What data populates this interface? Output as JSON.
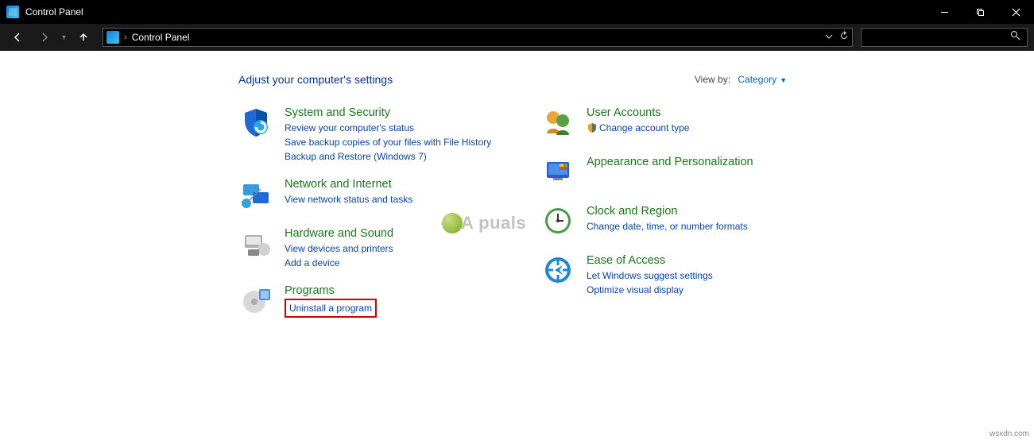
{
  "window": {
    "title": "Control Panel"
  },
  "address": {
    "path": "Control Panel"
  },
  "heading": "Adjust your computer's settings",
  "viewby": {
    "label": "View by:",
    "value": "Category"
  },
  "left_column": [
    {
      "title": "System and Security",
      "icon": "shield",
      "links": [
        {
          "text": "Review your computer's status"
        },
        {
          "text": "Save backup copies of your files with File History"
        },
        {
          "text": "Backup and Restore (Windows 7)"
        }
      ]
    },
    {
      "title": "Network and Internet",
      "icon": "network",
      "links": [
        {
          "text": "View network status and tasks"
        }
      ]
    },
    {
      "title": "Hardware and Sound",
      "icon": "hardware",
      "links": [
        {
          "text": "View devices and printers"
        },
        {
          "text": "Add a device"
        }
      ]
    },
    {
      "title": "Programs",
      "icon": "programs",
      "links": [
        {
          "text": "Uninstall a program",
          "highlight": true
        }
      ]
    }
  ],
  "right_column": [
    {
      "title": "User Accounts",
      "icon": "users",
      "links": [
        {
          "text": "Change account type",
          "badge": true
        }
      ]
    },
    {
      "title": "Appearance and Personalization",
      "icon": "appearance",
      "links": []
    },
    {
      "title": "Clock and Region",
      "icon": "clock",
      "links": [
        {
          "text": "Change date, time, or number formats"
        }
      ]
    },
    {
      "title": "Ease of Access",
      "icon": "ease",
      "links": [
        {
          "text": "Let Windows suggest settings"
        },
        {
          "text": "Optimize visual display"
        }
      ]
    }
  ],
  "watermark": "A   puals",
  "credit": "wsxdn.com"
}
